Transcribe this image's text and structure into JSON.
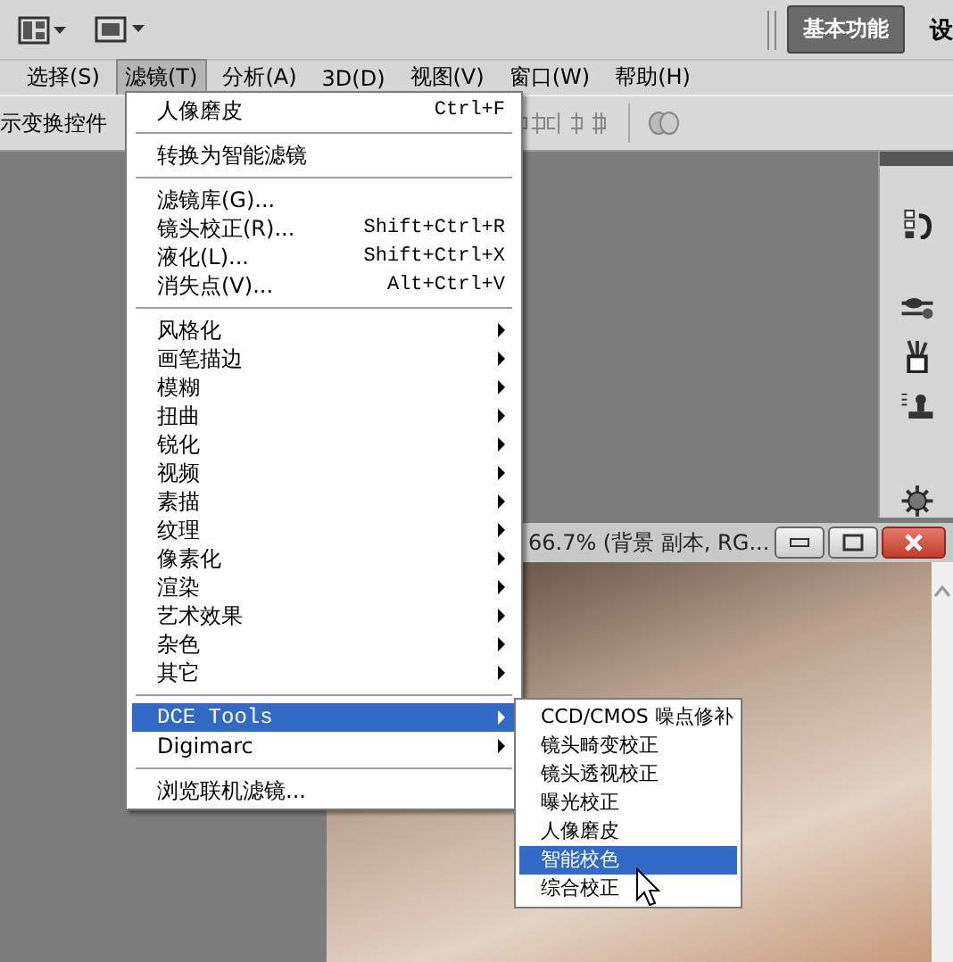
{
  "app_bar": {
    "workspace_button": "基本功能",
    "cut_label": "设"
  },
  "menubar": [
    {
      "label": "选择(S)",
      "selected": false
    },
    {
      "label": "滤镜(T)",
      "selected": true
    },
    {
      "label": "分析(A)",
      "selected": false
    },
    {
      "label": "3D(D)",
      "selected": false
    },
    {
      "label": "视图(V)",
      "selected": false
    },
    {
      "label": "窗口(W)",
      "selected": false
    },
    {
      "label": "帮助(H)",
      "selected": false
    }
  ],
  "options_bar": {
    "label": "示变换控件"
  },
  "filter_menu": [
    [
      {
        "label": "人像磨皮",
        "shortcut": "Ctrl+F",
        "submenu": false,
        "selected": false
      }
    ],
    [
      {
        "label": "转换为智能滤镜",
        "submenu": false,
        "selected": false
      }
    ],
    [
      {
        "label": "滤镜库(G)...",
        "submenu": false,
        "selected": false
      },
      {
        "label": "镜头校正(R)...",
        "shortcut": "Shift+Ctrl+R",
        "submenu": false,
        "selected": false
      },
      {
        "label": "液化(L)...",
        "shortcut": "Shift+Ctrl+X",
        "submenu": false,
        "selected": false
      },
      {
        "label": "消失点(V)...",
        "shortcut": "Alt+Ctrl+V",
        "submenu": false,
        "selected": false
      }
    ],
    [
      {
        "label": "风格化",
        "submenu": true,
        "selected": false
      },
      {
        "label": "画笔描边",
        "submenu": true,
        "selected": false
      },
      {
        "label": "模糊",
        "submenu": true,
        "selected": false
      },
      {
        "label": "扭曲",
        "submenu": true,
        "selected": false
      },
      {
        "label": "锐化",
        "submenu": true,
        "selected": false
      },
      {
        "label": "视频",
        "submenu": true,
        "selected": false
      },
      {
        "label": "素描",
        "submenu": true,
        "selected": false
      },
      {
        "label": "纹理",
        "submenu": true,
        "selected": false
      },
      {
        "label": "像素化",
        "submenu": true,
        "selected": false
      },
      {
        "label": "渲染",
        "submenu": true,
        "selected": false
      },
      {
        "label": "艺术效果",
        "submenu": true,
        "selected": false
      },
      {
        "label": "杂色",
        "submenu": true,
        "selected": false
      },
      {
        "label": "其它",
        "submenu": true,
        "selected": false
      }
    ],
    [
      {
        "label": "DCE Tools",
        "submenu": true,
        "selected": true
      },
      {
        "label": "Digimarc",
        "submenu": true,
        "selected": false
      }
    ],
    [
      {
        "label": "浏览联机滤镜...",
        "submenu": false,
        "selected": false
      }
    ]
  ],
  "dce_submenu": [
    {
      "label": "CCD/CMOS 噪点修补",
      "selected": false
    },
    {
      "label": "镜头畸变校正",
      "selected": false
    },
    {
      "label": "镜头透视校正",
      "selected": false
    },
    {
      "label": "曝光校正",
      "selected": false
    },
    {
      "label": "人像磨皮",
      "selected": false
    },
    {
      "label": "智能校色",
      "selected": true
    },
    {
      "label": "综合校正",
      "selected": false
    }
  ],
  "document": {
    "title": "66.7% (背景 副本, RG..."
  }
}
